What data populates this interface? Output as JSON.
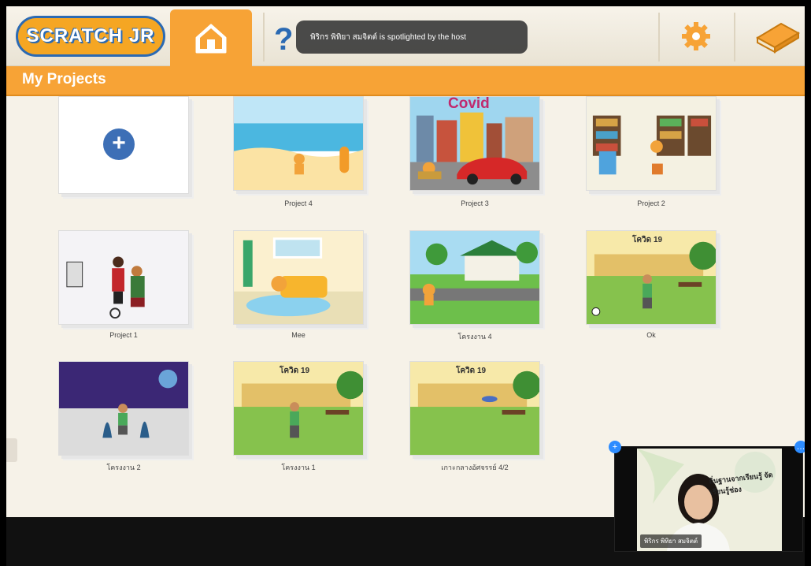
{
  "app": {
    "logo_text": "SCRATCH JR",
    "page_title": "My Projects"
  },
  "notification": {
    "text": "พิริกร พิทิยา สมจิตต์ is spotlighted by the host"
  },
  "icons": {
    "home": "home-icon",
    "help": "question-icon",
    "settings": "gear-icon",
    "book": "book-icon",
    "new_project": "plus-icon"
  },
  "projects": [
    {
      "label": "Project 4"
    },
    {
      "label": "Project 3",
      "overlay_text": "Covid"
    },
    {
      "label": "Project 2"
    },
    {
      "label": "Project 1"
    },
    {
      "label": "Mee"
    },
    {
      "label": "โครงงาน 4"
    },
    {
      "label": "Ok",
      "overlay_text": "โควิด 19"
    },
    {
      "label": "โครงงาน 2"
    },
    {
      "label": "โครงงาน 1",
      "overlay_text": "โควิด 19"
    },
    {
      "label": "เกาะกลางอัศจรรย์ 4/2",
      "overlay_text": "โควิด 19"
    }
  ],
  "video": {
    "participant_name": "พิริกร พิทิยา สมจิตต์",
    "slide_text": "ถิ่นฐานจากเรียนรู้ จัดเรียนรู้ช่อง"
  },
  "colors": {
    "accent_orange": "#f7a336",
    "brand_blue": "#2b6ab3",
    "background": "#f6f2e8"
  }
}
